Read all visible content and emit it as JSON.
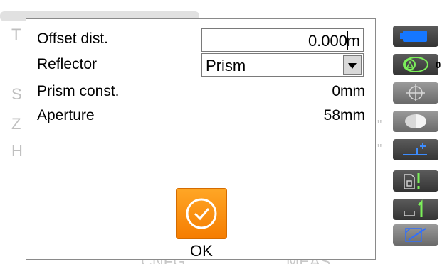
{
  "background": {
    "footer_left": "CNFG",
    "footer_right": "MEAS"
  },
  "dialog": {
    "rows": [
      {
        "label": "Offset dist.",
        "value": "0.000",
        "unit": "m"
      },
      {
        "label": "Reflector",
        "selected": "Prism"
      },
      {
        "label": "Prism const.",
        "value": "0",
        "unit": "mm"
      },
      {
        "label": "Aperture",
        "value": "58",
        "unit": "mm"
      }
    ],
    "ok_label": "OK"
  },
  "toolbar": {
    "items": [
      {
        "icon": "battery-icon"
      },
      {
        "icon": "prism-target-icon",
        "badge": "0"
      },
      {
        "icon": "crosshair-icon"
      },
      {
        "icon": "half-circle-icon"
      },
      {
        "icon": "plus-level-icon"
      },
      {
        "icon": "sd-card-alert-icon"
      },
      {
        "icon": "page-1-icon"
      },
      {
        "icon": "pencil-icon"
      }
    ]
  },
  "colors": {
    "accent_orange": "#f57c00",
    "toolbar_dark": "#404040",
    "battery_blue": "#1677ff",
    "signal_green": "#7cf05a"
  }
}
